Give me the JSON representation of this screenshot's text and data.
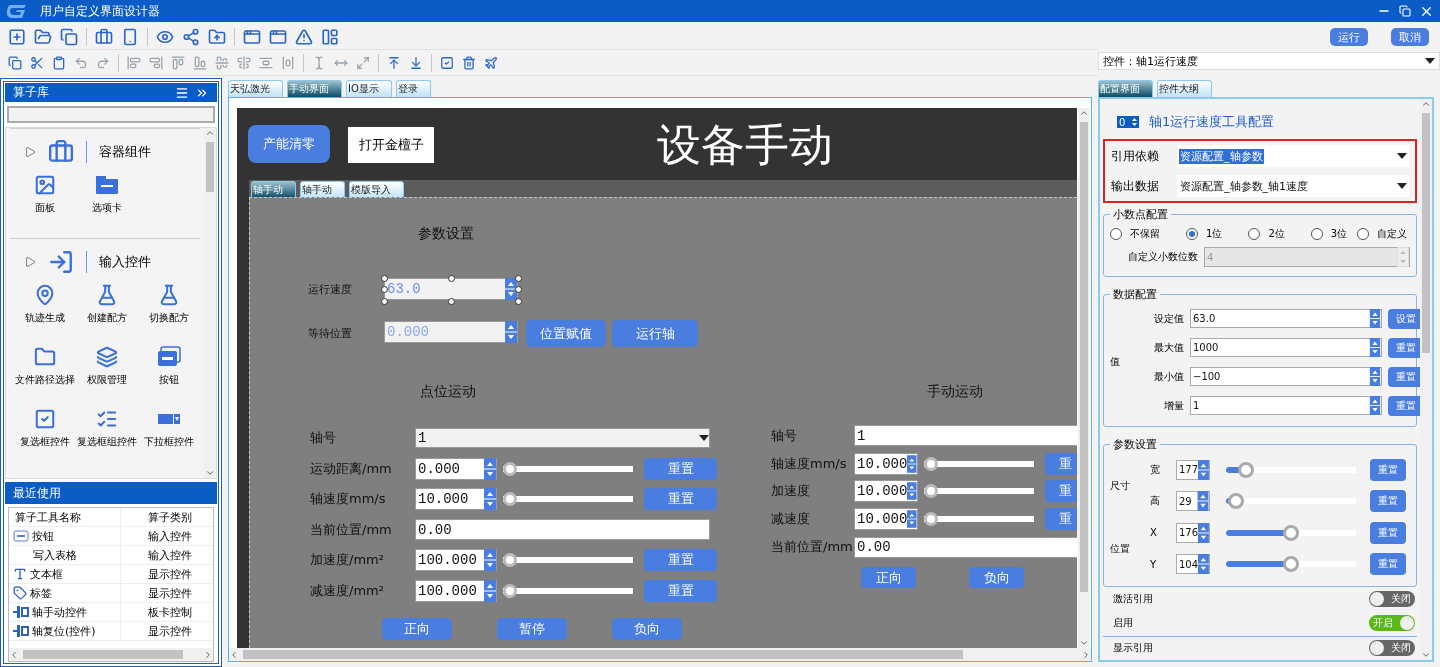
{
  "window": {
    "title": "用户自定义界面设计器"
  },
  "header": {
    "buttons": [
      "运行",
      "取消"
    ],
    "control_select": "控件：轴1运行速度"
  },
  "library": {
    "title": "算子库",
    "sections": [
      {
        "title": "容器组件",
        "items": [
          "面板",
          "选项卡"
        ]
      },
      {
        "title": "输入控件",
        "items": [
          "轨迹生成",
          "创建配方",
          "切换配方",
          "文件路径选择",
          "权限管理",
          "按钮",
          "复选框控件",
          "复选框组控件",
          "下拉框控件"
        ]
      }
    ]
  },
  "recent": {
    "title": "最近使用",
    "columns": [
      "算子工具名称",
      "算子类别"
    ],
    "rows": [
      [
        "按钮",
        "输入控件"
      ],
      [
        "写入表格",
        "输入控件"
      ],
      [
        "文本框",
        "显示控件"
      ],
      [
        "标签",
        "显示控件"
      ],
      [
        "轴手动控件",
        "板卡控制"
      ],
      [
        "轴复位(控件)",
        "显示控件"
      ]
    ]
  },
  "canvas": {
    "tabs": [
      {
        "label": "天弘激光",
        "selected": false
      },
      {
        "label": "手动界面",
        "selected": true
      },
      {
        "label": "IO显示",
        "selected": false
      },
      {
        "label": "登录",
        "selected": false
      }
    ],
    "screen": {
      "clear_button": "产能清零",
      "open_button": "打开金檀子",
      "title": "设备手动",
      "tabs": [
        {
          "label": "轴手动",
          "selected": true
        },
        {
          "label": "轴手动",
          "selected": false
        },
        {
          "label": "模版导入",
          "selected": false
        }
      ],
      "params": {
        "title": "参数设置",
        "speed": {
          "label": "运行速度",
          "value": "63.0"
        },
        "wait": {
          "label": "等待位置",
          "value": "0.000"
        },
        "buttons": [
          "位置赋值",
          "运行轴"
        ]
      },
      "point": {
        "title": "点位运动",
        "rows": [
          {
            "kind": "combo",
            "label": "轴号",
            "value": "1"
          },
          {
            "kind": "spin",
            "label": "运动距离/mm",
            "value": "0.000",
            "level": 0,
            "button": "重置"
          },
          {
            "kind": "spin",
            "label": "轴速度mm/s",
            "value": "10.000",
            "level": 0,
            "button": "重置"
          },
          {
            "kind": "field",
            "label": "当前位置/mm",
            "value": "0.00"
          },
          {
            "kind": "spin",
            "label": "加速度/mm²",
            "value": "100.000",
            "level": 0,
            "button": "重置"
          },
          {
            "kind": "spin",
            "label": "减速度/mm²",
            "value": "100.000",
            "level": 0,
            "button": "重置"
          }
        ],
        "buttons": [
          "正向",
          "暂停",
          "负向"
        ]
      },
      "manual": {
        "title": "手动运动",
        "rows": [
          {
            "kind": "field",
            "label": "轴号",
            "value": "1"
          },
          {
            "kind": "spin",
            "label": "轴速度mm/s",
            "value": "10.000",
            "level": 0,
            "button": "重"
          },
          {
            "kind": "spin",
            "label": "加速度",
            "value": "10.000",
            "level": 0,
            "button": "重"
          },
          {
            "kind": "spin",
            "label": "减速度",
            "value": "10.000",
            "level": 0,
            "button": "重"
          },
          {
            "kind": "field",
            "label": "当前位置/mm",
            "value": "0.00"
          }
        ],
        "buttons": [
          "正向",
          "负向"
        ]
      }
    }
  },
  "config": {
    "tabs": [
      {
        "label": "配置界面",
        "selected": true
      },
      {
        "label": "控件大纲",
        "selected": false
      }
    ],
    "index": "0",
    "title": "轴1运行速度工具配置",
    "bindings": [
      {
        "label": "引用依赖",
        "value": "资源配置_轴参数",
        "selected": true
      },
      {
        "label": "输出数据",
        "value": "资源配置_轴参数_轴1速度",
        "selected": false
      }
    ],
    "decimal": {
      "title": "小数点配置",
      "options": [
        {
          "label": "不保留",
          "selected": false
        },
        {
          "label": "1位",
          "selected": true
        },
        {
          "label": "2位",
          "selected": false
        },
        {
          "label": "3位",
          "selected": false
        },
        {
          "label": "自定义",
          "selected": false
        }
      ],
      "custom": {
        "label": "自定义小数位数",
        "value": "4",
        "disabled": true
      }
    },
    "data": {
      "title": "数据配置",
      "side_label": "值",
      "rows": [
        {
          "label": "设定值",
          "value": "63.0",
          "button": "设置"
        },
        {
          "label": "最大值",
          "value": "1000",
          "button": "重置"
        },
        {
          "label": "最小值",
          "value": "−100",
          "button": "重置"
        },
        {
          "label": "增量",
          "value": "1",
          "button": "重置"
        }
      ]
    },
    "params": {
      "title": "参数设置",
      "groups": [
        {
          "label": "尺寸",
          "rows": [
            {
              "label": "宽",
              "value": "177",
              "level": 0.15,
              "button": "重置"
            },
            {
              "label": "高",
              "value": "29",
              "level": 0.08,
              "button": "重置"
            }
          ]
        },
        {
          "label": "位置",
          "rows": [
            {
              "label": "X",
              "value": "176",
              "level": 0.5,
              "button": "重置"
            },
            {
              "label": "Y",
              "value": "104",
              "level": 0.5,
              "button": "重置"
            }
          ]
        }
      ]
    },
    "toggles": [
      {
        "label": "激活引用",
        "on": false,
        "text": "关闭"
      },
      {
        "label": "启用",
        "on": true,
        "text": "开启"
      },
      {
        "label": "显示引用",
        "on": false,
        "text": "关闭"
      }
    ]
  }
}
